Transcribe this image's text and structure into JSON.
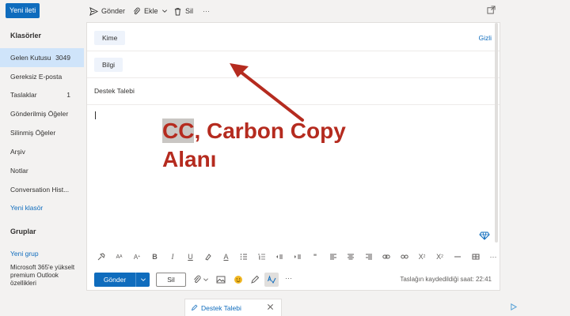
{
  "topbar": {
    "new_message": "Yeni ileti",
    "send": "Gönder",
    "attach": "Ekle",
    "delete": "Sil",
    "more": "···"
  },
  "sidebar": {
    "folders_heading": "Klasörler",
    "items": [
      {
        "label": "Gelen Kutusu",
        "count": "3049",
        "active": true
      },
      {
        "label": "Gereksiz E-posta",
        "count": ""
      },
      {
        "label": "Taslaklar",
        "count": "1"
      },
      {
        "label": "Gönderilmiş Öğeler",
        "count": ""
      },
      {
        "label": "Silinmiş Öğeler",
        "count": ""
      },
      {
        "label": "Arşiv",
        "count": ""
      },
      {
        "label": "Notlar",
        "count": ""
      },
      {
        "label": "Conversation Hist...",
        "count": ""
      }
    ],
    "new_folder": "Yeni klasör",
    "groups_heading": "Gruplar",
    "new_group": "Yeni grup",
    "promo": "Microsoft 365'e yükselt premium Outlook özellikleri"
  },
  "compose": {
    "to_label": "Kime",
    "bcc_label": "Gizli",
    "cc_label": "Bilgi",
    "subject": "Destek Talebi",
    "format_more": "···",
    "send_label": "Gönder",
    "discard_label": "Sil",
    "actions_more": "···",
    "saved_text": "Taslağın kaydedildiği saat: 22:41"
  },
  "bottom": {
    "tab_label": "Destek Talebi"
  },
  "annotation": {
    "highlight": "CC",
    "line1_rest": ", Carbon Copy",
    "line2": "Alanı",
    "color": "#b52b1f"
  },
  "colors": {
    "accent": "#0f6cbd",
    "selected": "#cfe4fa"
  }
}
